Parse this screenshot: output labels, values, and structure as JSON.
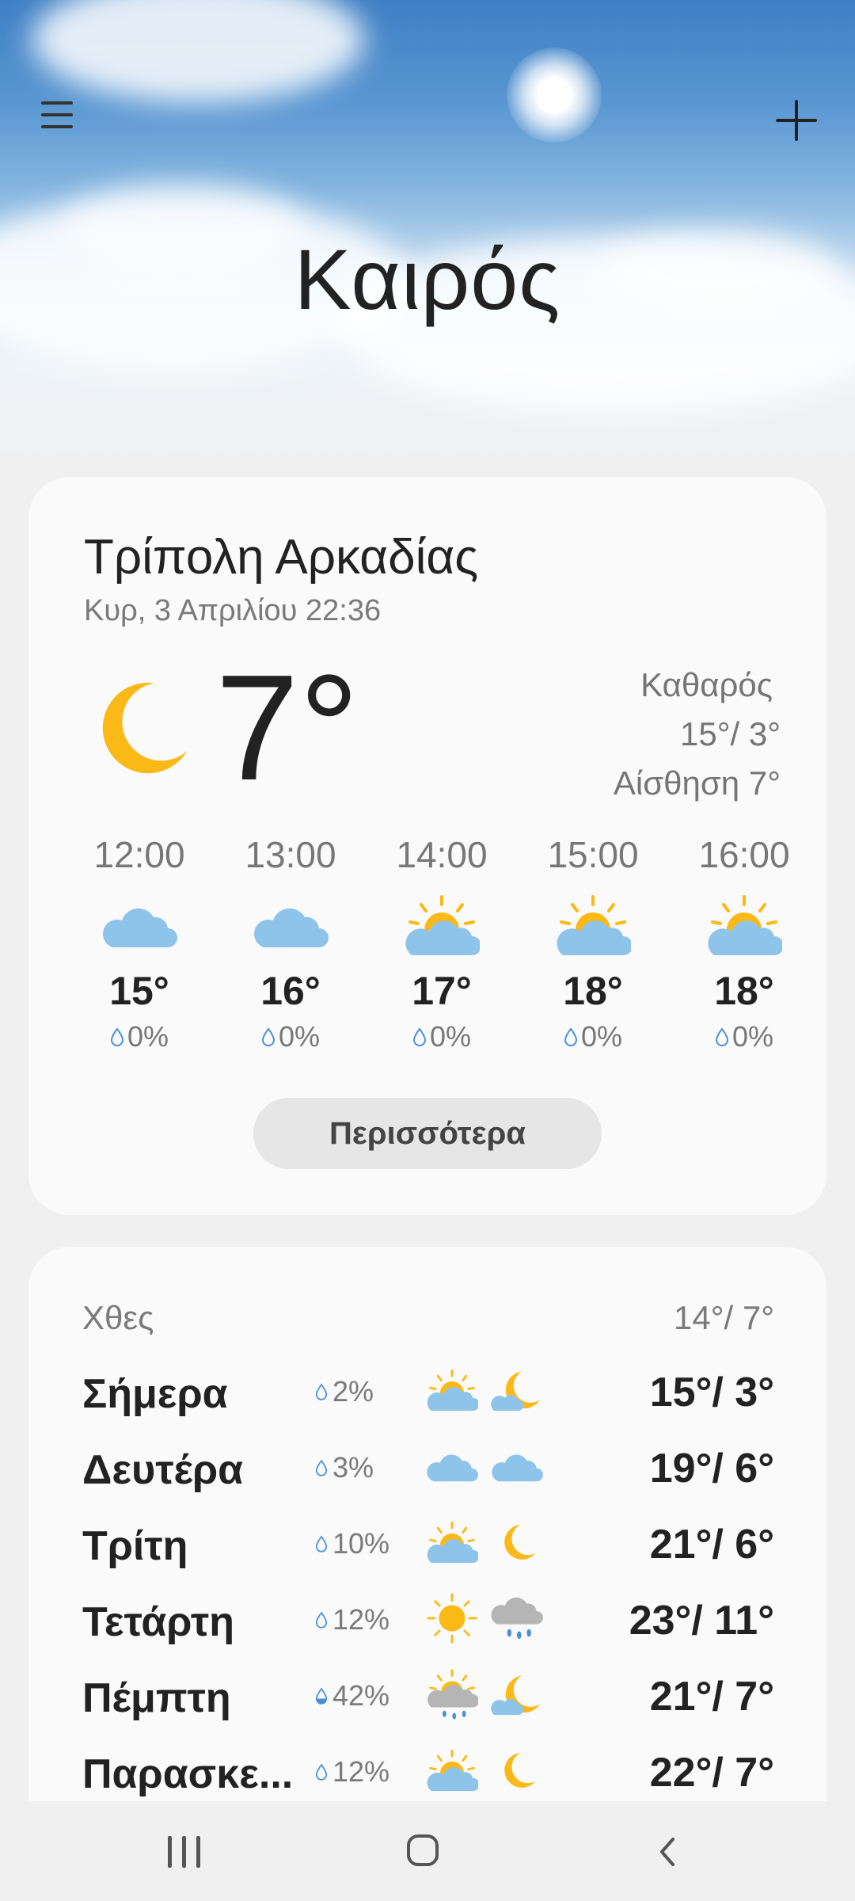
{
  "header": {
    "title": "Καιρός"
  },
  "current": {
    "location": "Τρίπολη Αρκαδίας",
    "datetime": "Κυρ, 3 Απριλίου 22:36",
    "icon": "moon-icon",
    "temperature": "7°",
    "condition": "Καθαρός",
    "high_low": "15°/ 3°",
    "feels_like": "Αίσθηση 7°",
    "more_label": "Περισσότερα",
    "hourly": [
      {
        "time": "12:00",
        "icon": "cloud-icon",
        "temp": "15°",
        "precip": "0%"
      },
      {
        "time": "13:00",
        "icon": "cloud-icon",
        "temp": "16°",
        "precip": "0%"
      },
      {
        "time": "14:00",
        "icon": "partly-sunny-icon",
        "temp": "17°",
        "precip": "0%"
      },
      {
        "time": "15:00",
        "icon": "partly-sunny-icon",
        "temp": "18°",
        "precip": "0%"
      },
      {
        "time": "16:00",
        "icon": "partly-sunny-icon",
        "temp": "18°",
        "precip": "0%"
      }
    ]
  },
  "daily": {
    "yesterday_label": "Χθες",
    "yesterday_temp": "14°/ 7°",
    "days": [
      {
        "name": "Σήμερα",
        "precip": "2%",
        "day_icon": "partly-sunny-icon",
        "night_icon": "partly-cloudy-night-icon",
        "temps": "15°/ 3°"
      },
      {
        "name": "Δευτέρα",
        "precip": "3%",
        "day_icon": "cloud-icon",
        "night_icon": "cloud-icon",
        "temps": "19°/ 6°"
      },
      {
        "name": "Τρίτη",
        "precip": "10%",
        "day_icon": "partly-sunny-icon",
        "night_icon": "moon-icon",
        "temps": "21°/ 6°"
      },
      {
        "name": "Τετάρτη",
        "precip": "12%",
        "day_icon": "sun-icon",
        "night_icon": "rain-cloud-icon",
        "temps": "23°/ 11°"
      },
      {
        "name": "Πέμπτη",
        "precip": "42%",
        "day_icon": "sun-rain-icon",
        "night_icon": "partly-cloudy-night-icon",
        "temps": "21°/ 7°"
      },
      {
        "name": "Παρασκε...",
        "precip": "12%",
        "day_icon": "partly-sunny-icon",
        "night_icon": "moon-icon",
        "temps": "22°/ 7°"
      }
    ]
  },
  "colors": {
    "sun": "#FBB917",
    "cloud": "#8EC3EA",
    "rain_cloud": "#B5B5B5",
    "drop": "#4A90D9"
  }
}
